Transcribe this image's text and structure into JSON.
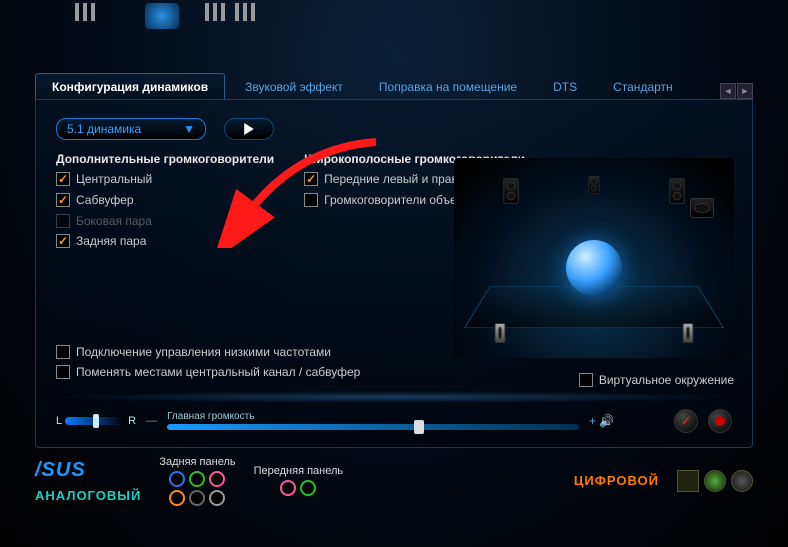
{
  "tabs": {
    "items": [
      {
        "label": "Конфигурация динамиков",
        "active": true
      },
      {
        "label": "Звуковой эффект"
      },
      {
        "label": "Поправка на помещение"
      },
      {
        "label": "DTS"
      },
      {
        "label": "Стандартн"
      }
    ]
  },
  "dropdown": {
    "value": "5.1 динамика"
  },
  "columns": {
    "additional": {
      "title": "Дополнительные громкоговорители",
      "items": [
        {
          "label": "Центральный",
          "checked": true
        },
        {
          "label": "Сабвуфер",
          "checked": true
        },
        {
          "label": "Боковая пара",
          "checked": false,
          "disabled": true
        },
        {
          "label": "Задняя пара",
          "checked": true
        }
      ]
    },
    "fullrange": {
      "title": "Широкополосные громкоговорители",
      "items": [
        {
          "label": "Передние левый и правый",
          "checked": true
        },
        {
          "label": "Громкоговорители объемного звука",
          "checked": false
        }
      ]
    }
  },
  "extras": [
    {
      "label": "Подключение управления низкими частотами",
      "checked": false
    },
    {
      "label": "Поменять местами центральный канал / сабвуфер",
      "checked": false
    }
  ],
  "virtual": {
    "label": "Виртуальное окружение",
    "checked": false
  },
  "volume": {
    "balanceL": "L",
    "balanceR": "R",
    "mainLabel": "Главная громкость",
    "plus": "+"
  },
  "footer": {
    "logo": "/SUS",
    "rearLabel": "Задняя панель",
    "frontLabel": "Передняя панель",
    "analog": "АНАЛОГОВЫЙ",
    "digital": "ЦИФРОВОЙ"
  }
}
